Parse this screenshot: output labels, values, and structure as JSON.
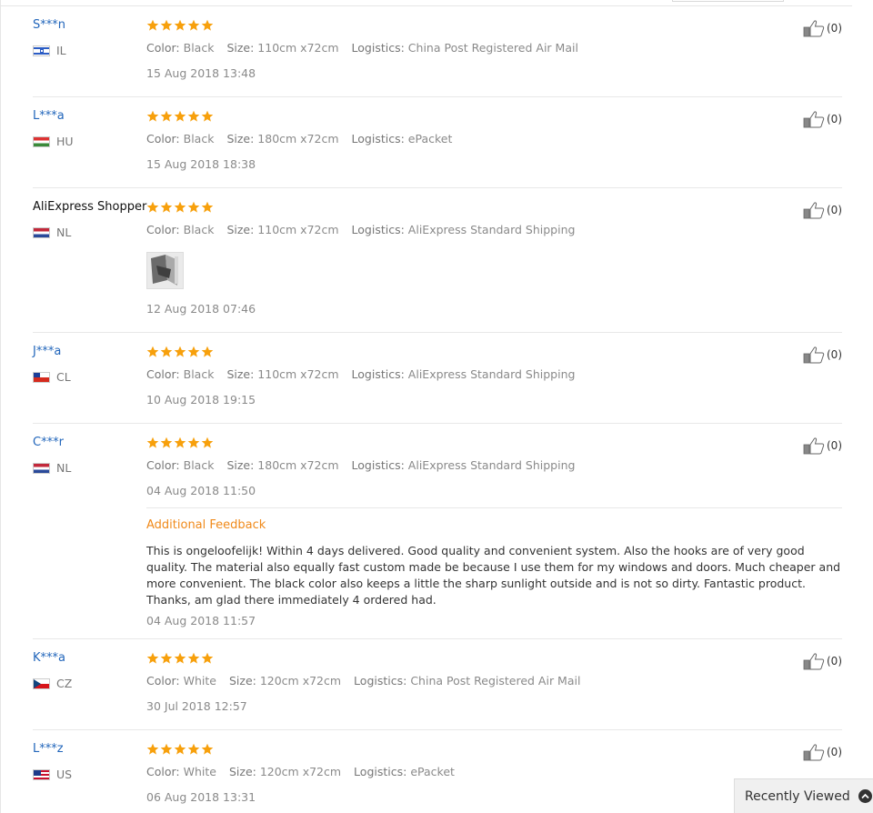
{
  "labels": {
    "color": "Color:",
    "size": "Size:",
    "logistics": "Logistics:",
    "additional_feedback": "Additional Feedback"
  },
  "reviews": [
    {
      "user": "S***n",
      "country": "IL",
      "color": "Black",
      "size": "110cm x72cm",
      "logistics": "China Post Registered Air Mail",
      "date": "15 Aug 2018 13:48",
      "likes": "(0)"
    },
    {
      "user": "L***a",
      "country": "HU",
      "color": "Black",
      "size": "180cm x72cm",
      "logistics": "ePacket",
      "date": "15 Aug 2018 18:38",
      "likes": "(0)"
    },
    {
      "user": "AliExpress Shopper",
      "country": "NL",
      "color": "Black",
      "size": "110cm x72cm",
      "logistics": "AliExpress Standard Shipping",
      "date": "12 Aug 2018 07:46",
      "likes": "(0)"
    },
    {
      "user": "J***a",
      "country": "CL",
      "color": "Black",
      "size": "110cm x72cm",
      "logistics": "AliExpress Standard Shipping",
      "date": "10 Aug 2018 19:15",
      "likes": "(0)"
    },
    {
      "user": "C***r",
      "country": "NL",
      "color": "Black",
      "size": "180cm x72cm",
      "logistics": "AliExpress Standard Shipping",
      "date": "04 Aug 2018 11:50",
      "likes": "(0)",
      "additional_text": "This is ongeloofelijk! Within 4 days delivered. Good quality and convenient system. Also the hooks are of very good quality. The material also equally fast custom made be because I use them for my windows and doors. Much cheaper and more convenient. The black color also keeps a little the sharp sunlight outside and is not so dirty. Fantastic product. Thanks, am glad there immediately 4 ordered had.",
      "additional_date": "04 Aug 2018 11:57"
    },
    {
      "user": "K***a",
      "country": "CZ",
      "color": "White",
      "size": "120cm x72cm",
      "logistics": "China Post Registered Air Mail",
      "date": "30 Jul 2018 12:57",
      "likes": "(0)"
    },
    {
      "user": "L***z",
      "country": "US",
      "color": "White",
      "size": "120cm x72cm",
      "logistics": "ePacket",
      "date": "06 Aug 2018 13:31",
      "likes": "(0)"
    }
  ],
  "recently_viewed": "Recently Viewed",
  "colors": {
    "star": "#f7a00c",
    "link": "#2266bb",
    "accent": "#f08a1a"
  }
}
